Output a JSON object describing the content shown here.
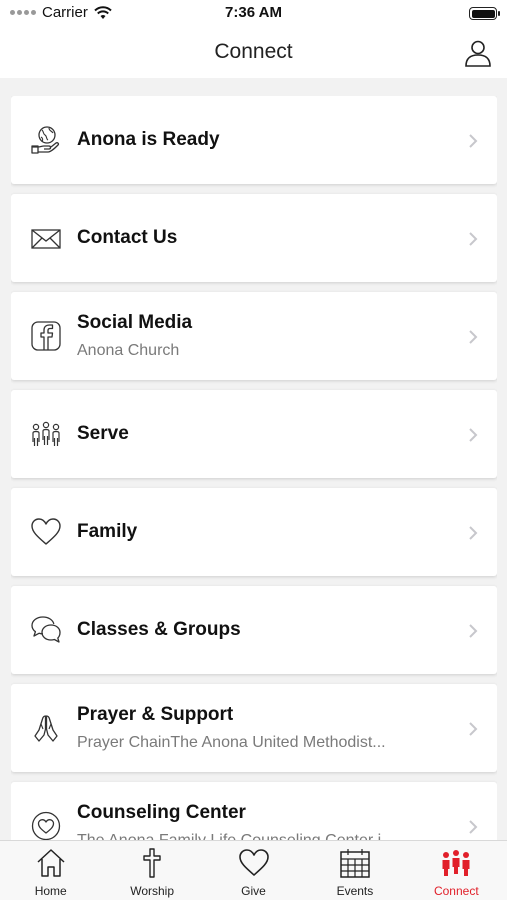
{
  "status": {
    "carrier": "Carrier",
    "time": "7:36 AM"
  },
  "header": {
    "title": "Connect"
  },
  "items": [
    {
      "title": "Anona is Ready",
      "subtitle": "",
      "icon": "globe-hand-icon"
    },
    {
      "title": "Contact Us",
      "subtitle": "",
      "icon": "envelope-icon"
    },
    {
      "title": "Social Media",
      "subtitle": "Anona Church",
      "icon": "facebook-icon"
    },
    {
      "title": "Serve",
      "subtitle": "",
      "icon": "people-icon"
    },
    {
      "title": "Family",
      "subtitle": "",
      "icon": "heart-icon"
    },
    {
      "title": "Classes & Groups",
      "subtitle": "",
      "icon": "chat-bubbles-icon"
    },
    {
      "title": "Prayer & Support",
      "subtitle": "Prayer ChainThe Anona United Methodist...",
      "icon": "praying-hands-icon"
    },
    {
      "title": "Counseling Center",
      "subtitle": "The Anona Family Life Counseling Center i...",
      "icon": "heart-circle-icon"
    }
  ],
  "tabs": [
    {
      "label": "Home",
      "icon": "home-icon",
      "active": false
    },
    {
      "label": "Worship",
      "icon": "cross-icon",
      "active": false
    },
    {
      "label": "Give",
      "icon": "heart-icon",
      "active": false
    },
    {
      "label": "Events",
      "icon": "calendar-icon",
      "active": false
    },
    {
      "label": "Connect",
      "icon": "people-icon",
      "active": true
    }
  ],
  "colors": {
    "accent": "#e1202a",
    "background": "#f2f2f2",
    "card": "#ffffff"
  }
}
